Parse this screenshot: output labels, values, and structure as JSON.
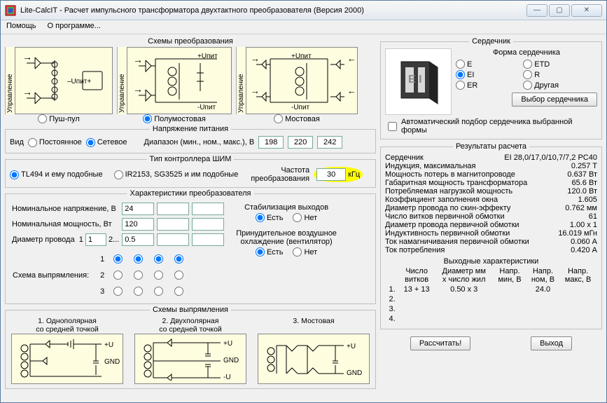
{
  "window": {
    "title": "Lite-CalcIT - Расчет импульсного трансформатора двухтактного преобразователя (Версия 2000)"
  },
  "menu": {
    "help": "Помощь",
    "about": "О программе..."
  },
  "conv": {
    "title": "Схемы  преобразования",
    "ctrl_v": "Управление",
    "pushpull": "Пуш-пул",
    "halfbridge": "Полумостовая",
    "fullbridge": "Мостовая",
    "upit_plus": "+Uпит",
    "upit_minus_lbl": "–Uпит+"
  },
  "supply": {
    "title": "Напряжение питания",
    "type_label": "Вид",
    "dc": "Постоянное",
    "ac": "Сетевое",
    "range_label": "Диапазон (мин., ном., макс.), В",
    "min": "198",
    "nom": "220",
    "max": "242"
  },
  "pwm": {
    "title": "Тип контроллера ШИМ",
    "opt_a": "TL494 и ему подобные",
    "opt_b": "IR2153, SG3525 и им подобные",
    "freq_label1": "Частота",
    "freq_label2": "преобразования",
    "freq_val": "30",
    "freq_unit": "кГц"
  },
  "params": {
    "title": "Характеристики преобразователя",
    "vnom_label": "Номинальное напряжение, В",
    "vnom": "24",
    "pnom_label": "Номинальная мощность, Вт",
    "pnom": "120",
    "dia_label": "Диаметр провода",
    "dia_a": "1",
    "dia_b_pref": "2...",
    "dia_b": "0.5",
    "rect_label": "Схема выпрямления:",
    "stab_label": "Стабилизация выходов",
    "yes": "Есть",
    "no": "Нет",
    "fan_label1": "Принудительное воздушное",
    "fan_label2": "охлаждение (вентилятор)",
    "row_1": "1",
    "row_2": "2",
    "row_3": "3"
  },
  "rect": {
    "title": "Схемы выпрямления",
    "s1a": "1. Однополярная",
    "s1b": "со средней точкой",
    "s2a": "2. Двухполярная",
    "s2b": "со средней точкой",
    "s3": "3. Мостовая",
    "u_plus": "+U",
    "u_minus": "-U",
    "gnd": "GND"
  },
  "core": {
    "title": "Сердечник",
    "shape_title": "Форма сердечника",
    "E": "E",
    "ETD": "ETD",
    "EI": "EI",
    "R": "R",
    "ER": "ER",
    "other": "Другая",
    "pick_btn": "Выбор сердечника",
    "auto_label": "Автоматический подбор сердечника выбранной формы"
  },
  "res": {
    "title": "Результаты расчета",
    "core_lbl": "Сердечник",
    "core_val": "EI 28,0/17,0/10,7/7,2 PC40",
    "bmax_lbl": "Индукция, максимальная",
    "bmax_val": "0.257 T",
    "ploss_lbl": "Мощность потерь в магнитопроводе",
    "ploss_val": "0.637 Вт",
    "pgab_lbl": "Габаритная мощность трансформатора",
    "pgab_val": "65.6 Вт",
    "pload_lbl": "Потребляемая нагрузкой мощность",
    "pload_val": "120.0 Вт",
    "kfill_lbl": "Коэффициент заполнения окна",
    "kfill_val": "1.605",
    "dskin_lbl": "Диаметр провода по скин-эффекту",
    "dskin_val": "0.762 мм",
    "nprim_lbl": "Число витков первичной обмотки",
    "nprim_val": "61",
    "dprim_lbl": "Диаметр провода первичной обмотки",
    "dprim_val": "1.00 x 1",
    "lprim_lbl": "Индуктивность первичной обмотки",
    "lprim_val": "16.019 мГн",
    "imag_lbl": "Ток намагничивания первичной обмотки",
    "imag_val": "0.060 А",
    "icons_lbl": "Ток потребления",
    "icons_val": "0.420 А",
    "out_title": "Выходные характеристики",
    "h_n": "Число\nвитков",
    "h_d": "Диаметр мм\nx число жил",
    "h_min": "Напр.\nмин, В",
    "h_nom": "Напр.\nном, В",
    "h_max": "Напр.\nмакс, В",
    "r1_num": "1.",
    "r1_turns": "13 + 13",
    "r1_dia": "0.50 x 3",
    "r1_min": "",
    "r1_nom": "24.0",
    "r1_max": "",
    "r2_num": "2.",
    "r3_num": "3.",
    "r4_num": "4."
  },
  "btns": {
    "calc": "Рассчитать!",
    "exit": "Выход"
  }
}
